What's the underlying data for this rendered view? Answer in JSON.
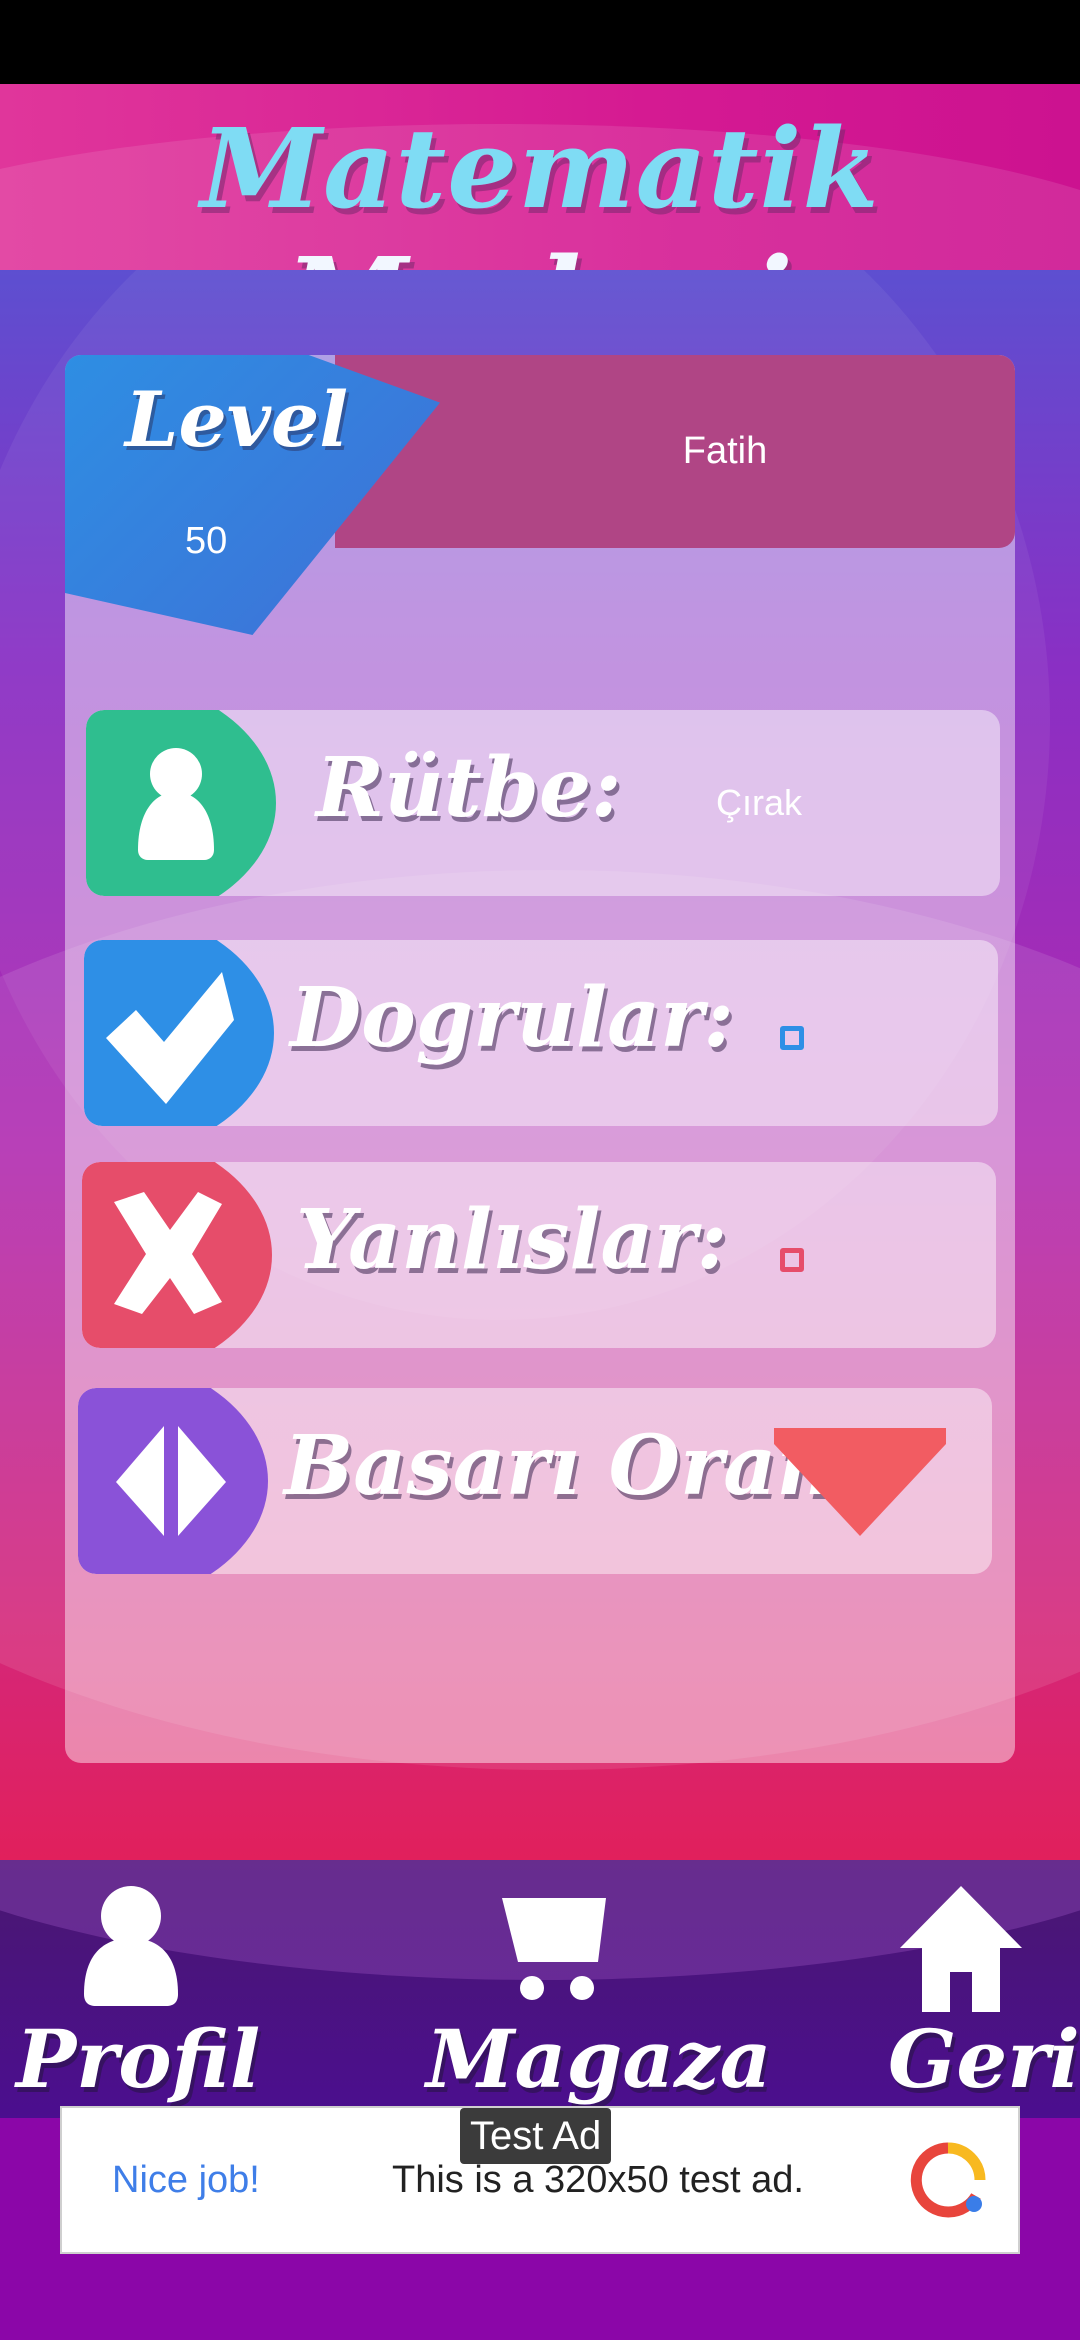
{
  "app": {
    "title_part1": "Matematik",
    "title_part2": " Merkezi"
  },
  "profile": {
    "level_label": "Level",
    "level_value": "50",
    "player_name": "Fatih"
  },
  "stats": [
    {
      "label": "Rütbe:",
      "value": "Çırak",
      "icon": "person-icon",
      "color": "#2fbe8f"
    },
    {
      "label": "Dogrular:",
      "value": "",
      "icon": "checkmark-icon",
      "color": "#2e8fe6"
    },
    {
      "label": "Yanlıslar:",
      "value": "",
      "icon": "cross-icon",
      "color": "#e64d6a"
    },
    {
      "label": "Basarı Oranı:",
      "value": "",
      "icon": "diamond-split-icon",
      "color": "#8a52d8"
    }
  ],
  "nav": {
    "profile_label": "Profil",
    "store_label": "Magaza",
    "back_label": "Geri"
  },
  "ad": {
    "badge": "Test Ad",
    "nice_job": "Nice job!",
    "text": "This is a 320x50 test ad."
  },
  "colors": {
    "header": "#d51a92",
    "accent_title": "#7fdcf4",
    "name_bar": "#b04585",
    "success_triangle": "#f25c62"
  }
}
